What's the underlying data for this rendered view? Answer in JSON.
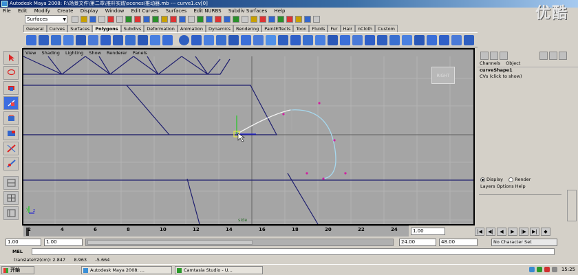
{
  "window": {
    "title": "Autodesk Maya 2008: F:\\场景文件\\第二章\\推杆实践\\scenes\\推动器.mb  ---  curve1.cv[0]",
    "watermark": "优酷"
  },
  "menubar": [
    "File",
    "Edit",
    "Modify",
    "Create",
    "Display",
    "Window",
    "Edit Curves",
    "Surfaces",
    "Edit NURBS",
    "Subdiv Surfaces",
    "Help"
  ],
  "statusline": {
    "mode": "Surfaces"
  },
  "shelf_tabs": [
    "General",
    "Curves",
    "Surfaces",
    "Polygons",
    "Subdivs",
    "Deformation",
    "Animation",
    "Dynamics",
    "Rendering",
    "PaintEffects",
    "Toon",
    "Fluids",
    "Fur",
    "Hair",
    "nCloth",
    "Custom"
  ],
  "shelf_active_tab": "Polygons",
  "viewport": {
    "panel_menu": [
      "View",
      "Shading",
      "Lighting",
      "Show",
      "Renderer",
      "Panels"
    ],
    "view_cube_label": "RIGHT",
    "camera_name": "side"
  },
  "channel_box": {
    "tabs": [
      "Channels",
      "Object"
    ],
    "node": "curveShape1",
    "attr": "CVs (click to show)"
  },
  "layer_editor": {
    "display_label": "Display",
    "render_label": "Render",
    "menus": [
      "Layers",
      "Options",
      "Help"
    ]
  },
  "time_slider": {
    "ticks": [
      "2",
      "4",
      "6",
      "8",
      "10",
      "12",
      "14",
      "16",
      "18",
      "20",
      "22",
      "24"
    ],
    "current_frame": "1.00"
  },
  "range": {
    "start": "1.00",
    "playback_start": "1.00",
    "bar_start": "1.00",
    "bar_end": "24.00",
    "playback_end": "24.00",
    "end": "48.00",
    "character_set": "No Character Set"
  },
  "command": {
    "label": "MEL"
  },
  "helpline": "translateY2(cm): 2.847      8.963      -5.664",
  "taskbar": {
    "start": "开始",
    "tasks": [
      "Autodesk Maya 2008: ...",
      "Camtasia Studio - U..."
    ],
    "clock": "15:25"
  }
}
